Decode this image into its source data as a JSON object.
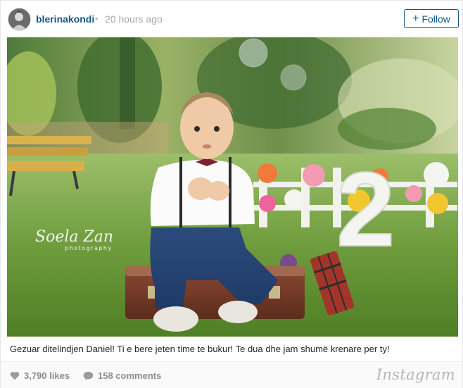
{
  "post": {
    "username": "blerinakondi",
    "separator": "•",
    "time_ago": "20 hours ago",
    "follow_label": "Follow",
    "follow_icon": "plus-icon",
    "caption": "Gezuar ditelindjen Daniel! Ti e bere jeten time te bukur! Te dua dhe jam shumë krenare per ty!",
    "likes": "3,790 likes",
    "comments": "158 comments",
    "brand": "Instagram",
    "photo_number": "2",
    "watermark_title": "Soela Zan",
    "watermark_subtitle": "photography",
    "accent_color": "#125688",
    "icons": [
      "heart-icon",
      "comment-icon"
    ]
  }
}
